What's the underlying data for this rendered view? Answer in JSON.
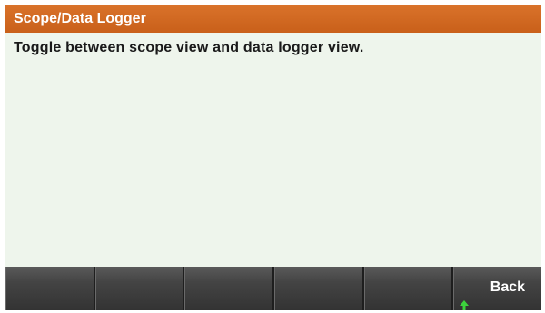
{
  "header": {
    "title": "Scope/Data Logger"
  },
  "help": {
    "text": "Toggle between scope view and data logger view."
  },
  "softkeys": [
    {
      "label": ""
    },
    {
      "label": ""
    },
    {
      "label": ""
    },
    {
      "label": ""
    },
    {
      "label": ""
    },
    {
      "label": "Back",
      "icon": "up-arrow-icon"
    }
  ],
  "colors": {
    "title_bar": "#d2691e",
    "background": "#eef5ec",
    "softkey": "#444444",
    "arrow": "#3cd23c"
  }
}
